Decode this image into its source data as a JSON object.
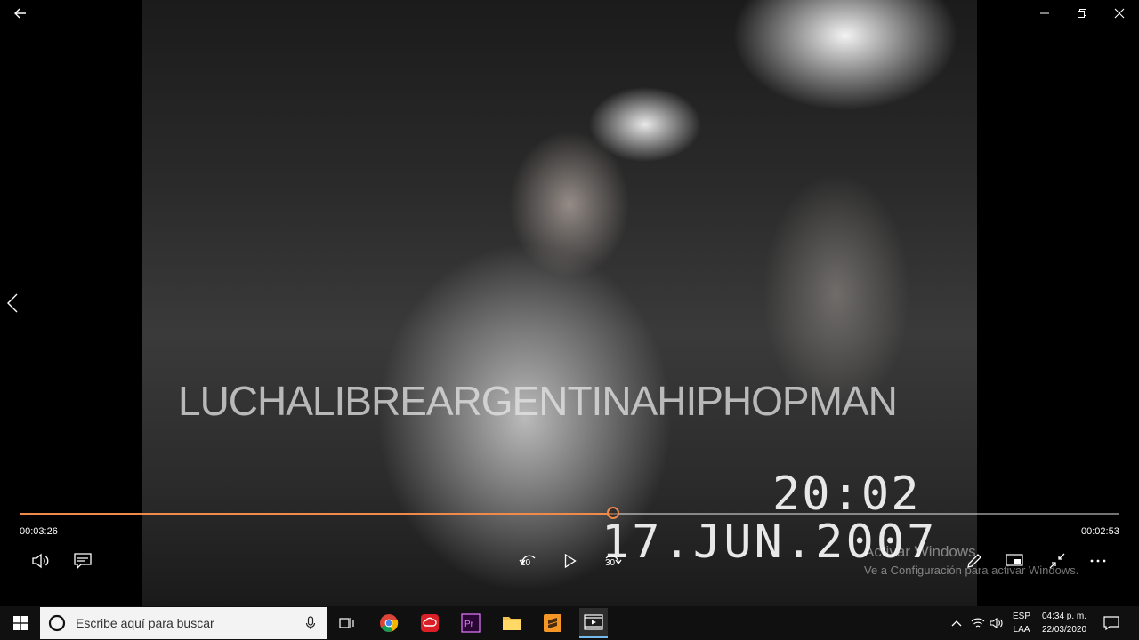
{
  "video": {
    "watermark": "LUCHALIBREARGENTINAHIPHOPMAN",
    "time_stamp": "20:02",
    "date_stamp": "17.JUN.2007"
  },
  "player": {
    "elapsed": "00:03:26",
    "remaining": "00:02:53",
    "progress": 0.54,
    "skip_back_seconds": "10",
    "skip_forward_seconds": "30",
    "accent": "#f08a4b"
  },
  "activation": {
    "title": "Activar Windows",
    "subtitle": "Ve a Configuración para activar Windows."
  },
  "taskbar": {
    "search_placeholder": "Escribe aquí para buscar",
    "language": "ESP",
    "layout": "LAA",
    "clock_time": "04:34 p. m.",
    "clock_date": "22/03/2020"
  }
}
